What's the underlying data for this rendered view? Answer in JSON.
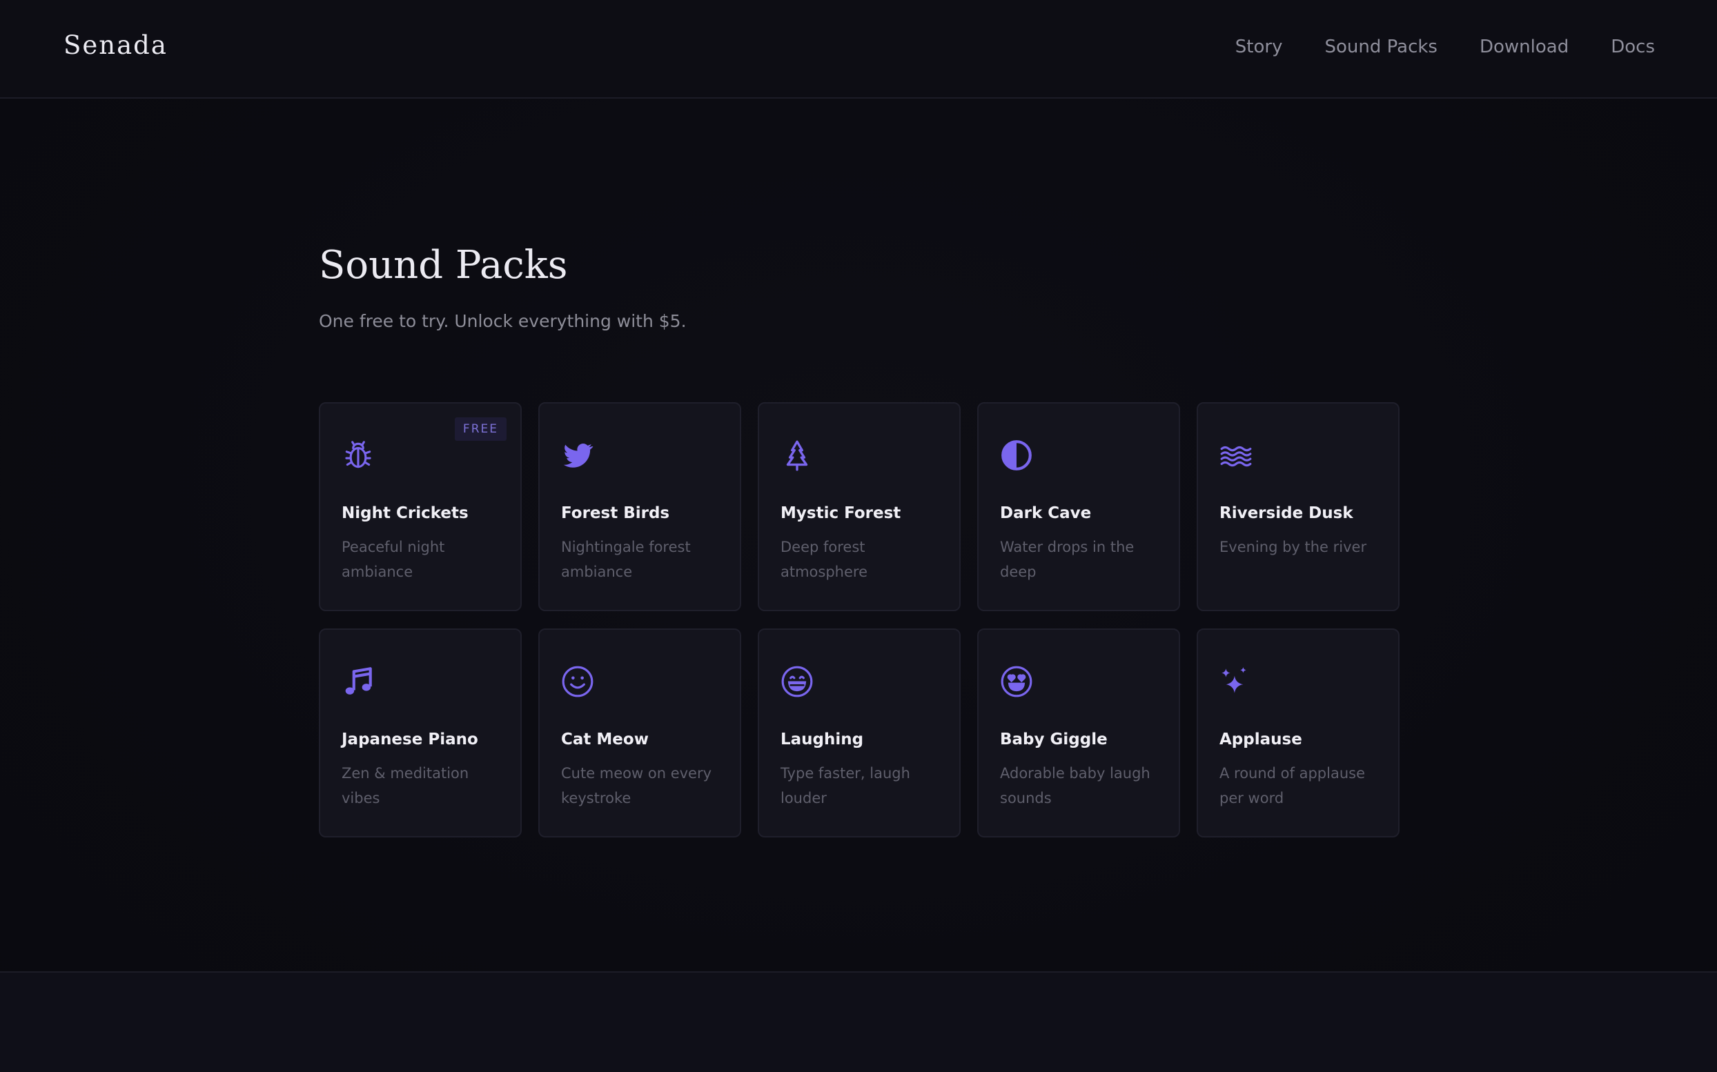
{
  "header": {
    "logo": "Senada",
    "nav": [
      "Story",
      "Sound Packs",
      "Download",
      "Docs"
    ]
  },
  "main": {
    "title": "Sound Packs",
    "subtitle": "One free to try. Unlock everything with $5."
  },
  "colors": {
    "accent": "#7a66ee",
    "background": "#0b0b11",
    "card": "#14141d"
  },
  "packs": [
    {
      "name": "Night Crickets",
      "desc": "Peaceful night ambiance",
      "icon": "bug-icon",
      "badge": "FREE"
    },
    {
      "name": "Forest Birds",
      "desc": "Nightingale forest ambiance",
      "icon": "bird-icon"
    },
    {
      "name": "Mystic Forest",
      "desc": "Deep forest atmosphere",
      "icon": "tree-icon"
    },
    {
      "name": "Dark Cave",
      "desc": "Water drops in the deep",
      "icon": "half-circle-icon"
    },
    {
      "name": "Riverside Dusk",
      "desc": "Evening by the river",
      "icon": "waves-icon"
    },
    {
      "name": "Japanese Piano",
      "desc": "Zen & meditation vibes",
      "icon": "music-note-icon"
    },
    {
      "name": "Cat Meow",
      "desc": "Cute meow on every keystroke",
      "icon": "smile-icon"
    },
    {
      "name": "Laughing",
      "desc": "Type faster, laugh louder",
      "icon": "laugh-icon"
    },
    {
      "name": "Baby Giggle",
      "desc": "Adorable baby laugh sounds",
      "icon": "heart-eyes-icon"
    },
    {
      "name": "Applause",
      "desc": "A round of applause per word",
      "icon": "sparkles-icon"
    }
  ]
}
